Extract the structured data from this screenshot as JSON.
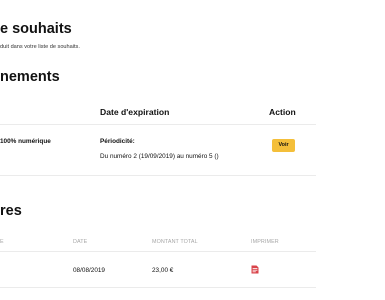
{
  "wishlist": {
    "title": "e souhaits",
    "subtitle": "duit dans votre liste de souhaits."
  },
  "subscriptions": {
    "title": "nements",
    "columns": {
      "expiration": "Date d'expiration",
      "action": "Action"
    },
    "row": {
      "product": "100% numérique",
      "periodicity_label": "Périodicité:",
      "periodicity_value": "Du numéro 2 (19/09/2019) au numéro 5 ()",
      "button_label": "Voir"
    }
  },
  "invoices": {
    "title": "res",
    "columns": {
      "first": "E",
      "date": "DATE",
      "amount": "MONTANT TOTAL",
      "print": "IMPRIMER"
    },
    "row": {
      "date": "08/08/2019",
      "amount": "23,00 €",
      "print_icon": "pdf-file-icon"
    }
  },
  "colors": {
    "accent": "#f4bf3a",
    "pdf_icon": "#d9434a"
  }
}
